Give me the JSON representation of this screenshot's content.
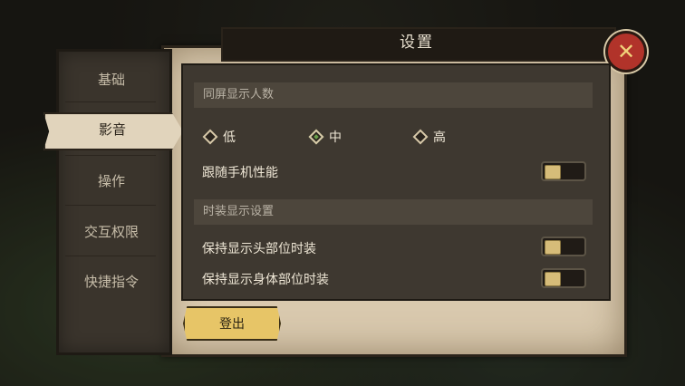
{
  "window": {
    "title": "设置"
  },
  "sidebar": {
    "items": [
      {
        "label": "基础",
        "active": false
      },
      {
        "label": "影音",
        "active": true
      },
      {
        "label": "操作",
        "active": false
      },
      {
        "label": "交互权限",
        "active": false
      },
      {
        "label": "快捷指令",
        "active": false
      }
    ]
  },
  "content": {
    "section1": {
      "header": "同屏显示人数",
      "options": [
        {
          "label": "低",
          "selected": false
        },
        {
          "label": "中",
          "selected": true
        },
        {
          "label": "高",
          "selected": false
        }
      ],
      "follow_performance_label": "跟随手机性能"
    },
    "section2": {
      "header": "时装显示设置",
      "rows": [
        {
          "label": "保持显示头部位时装"
        },
        {
          "label": "保持显示身体部位时装"
        }
      ]
    }
  },
  "footer": {
    "logout_label": "登出"
  },
  "colors": {
    "accent_green": "#6a9e4a",
    "button_gold": "#e7c567",
    "close_red": "#b1332a"
  },
  "icons": {
    "close": "close-x-icon",
    "toggle": "toggle-knob-icon"
  }
}
